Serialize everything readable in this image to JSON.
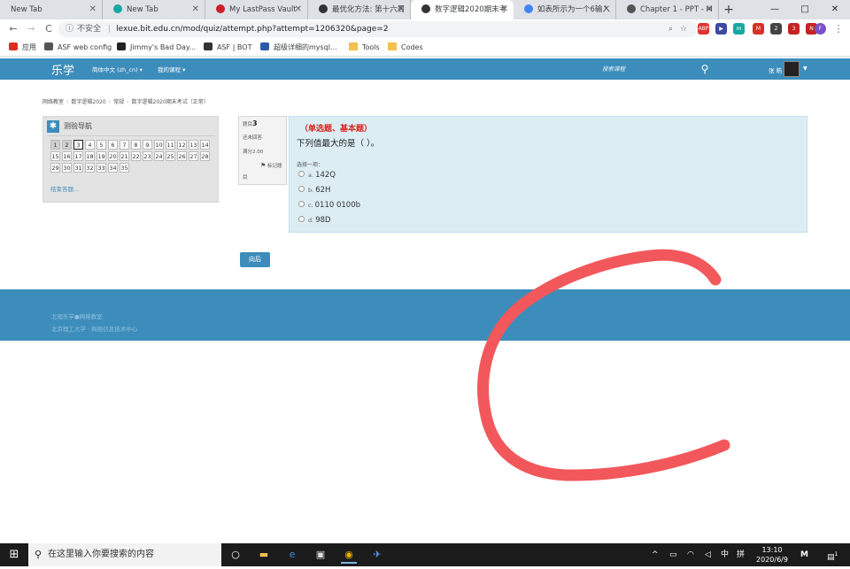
{
  "browser": {
    "tabs": [
      {
        "label": "New Tab",
        "fav_color": "",
        "active": false
      },
      {
        "label": "New Tab",
        "fav_color": "#16a8a0",
        "active": false
      },
      {
        "label": "My LastPass Vault",
        "fav_color": "#cc2029",
        "active": false
      },
      {
        "label": "最优化方法: 第十六周",
        "fav_color": "#333333",
        "active": false
      },
      {
        "label": "数字逻辑2020期末考",
        "fav_color": "#333333",
        "active": true
      },
      {
        "label": "如表所示为一个6输入",
        "fav_color": "#4285f4",
        "active": false
      },
      {
        "label": "Chapter 1 - PPT - M",
        "fav_color": "#555555",
        "active": false
      }
    ],
    "new_tab_symbol": "+",
    "window_controls": [
      "—",
      "□",
      "✕"
    ],
    "address": {
      "security": "不安全",
      "url": "lexue.bit.edu.cn/mod/quiz/attempt.php?attempt=1206320&page=2"
    },
    "bookmarks": [
      {
        "label": "应用",
        "icon": "apps-grid-icon"
      },
      {
        "label": "ASF web config",
        "icon": "globe-icon"
      },
      {
        "label": "Jimmy's Bad Day...",
        "icon": "jimmy-icon"
      },
      {
        "label": "ASF | BOT",
        "icon": "asf-icon"
      },
      {
        "label": "超级详细的mysql...",
        "icon": "csdn-icon"
      },
      {
        "label": "Tools",
        "icon": "folder-icon"
      },
      {
        "label": "Codes",
        "icon": "folder-icon"
      }
    ],
    "extensions": [
      {
        "name": "adblock-icon",
        "text": "ABP",
        "color": "#e0332f"
      },
      {
        "name": "play-icon",
        "text": "▶",
        "color": "#3c4aa0"
      },
      {
        "name": "mtm-icon",
        "text": "m",
        "color": "#16a8a0"
      },
      {
        "name": "gmail-icon",
        "text": "M",
        "color": "#d93025"
      },
      {
        "name": "ext-icon",
        "text": "2",
        "color": "#444444"
      },
      {
        "name": "ext-red-icon",
        "text": "3",
        "color": "#c5221f"
      },
      {
        "name": "ext-news-icon",
        "text": "N",
        "color": "#c5221f"
      },
      {
        "name": "profile-icon",
        "text": "F",
        "color": "#7b4fc9"
      }
    ]
  },
  "site": {
    "brand": "乐学",
    "menu": [
      "简体中文 (zh_cn) ▾",
      "我的课程 ▾"
    ],
    "search_placeholder": "搜索课程",
    "user_name": "张 皓",
    "breadcrumb": [
      "网络教室",
      "数字逻辑2020",
      "常规",
      "数字逻辑2020期末考试（正常）"
    ]
  },
  "quiz_nav": {
    "title": "测验导航",
    "buttons": [
      "1",
      "2",
      "3",
      "4",
      "5",
      "6",
      "7",
      "8",
      "9",
      "10",
      "11",
      "12",
      "13",
      "14",
      "15",
      "16",
      "17",
      "18",
      "19",
      "20",
      "21",
      "22",
      "23",
      "24",
      "25",
      "26",
      "27",
      "28",
      "29",
      "30",
      "31",
      "32",
      "33",
      "34",
      "35"
    ],
    "answered": [
      1,
      2
    ],
    "current": 3,
    "finish_link": "结束答题..."
  },
  "question": {
    "label": "题目",
    "number": "3",
    "state": "还未回答",
    "mark": "满分2.00",
    "flag_label": "标记题",
    "flag_tail": "目",
    "type": "（单选题、基本题）",
    "text": "下列值最大的是（    ）。",
    "prompt": "选择一项：",
    "options": [
      {
        "letter": "a.",
        "text": "142Q"
      },
      {
        "letter": "b.",
        "text": "62H"
      },
      {
        "letter": "c.",
        "text": "0110 0100b"
      },
      {
        "letter": "d.",
        "text": "98D"
      }
    ]
  },
  "next_button": "向后",
  "footer": {
    "line1": "北理乐学●网络教室",
    "line2": "北京理工大学 · 网络信息技术中心"
  },
  "annotation": {
    "color": "#f2585b",
    "shape": "handwritten C"
  },
  "taskbar": {
    "search_placeholder": "在这里输入你要搜索的内容",
    "apps": [
      "task-view-icon",
      "file-explorer-icon",
      "edge-icon",
      "store-icon",
      "chrome-icon",
      "app-icon"
    ],
    "tray": [
      "^",
      "中",
      "拼"
    ],
    "time": "13:10",
    "date": "2020/6/9",
    "notification_count": "1"
  }
}
